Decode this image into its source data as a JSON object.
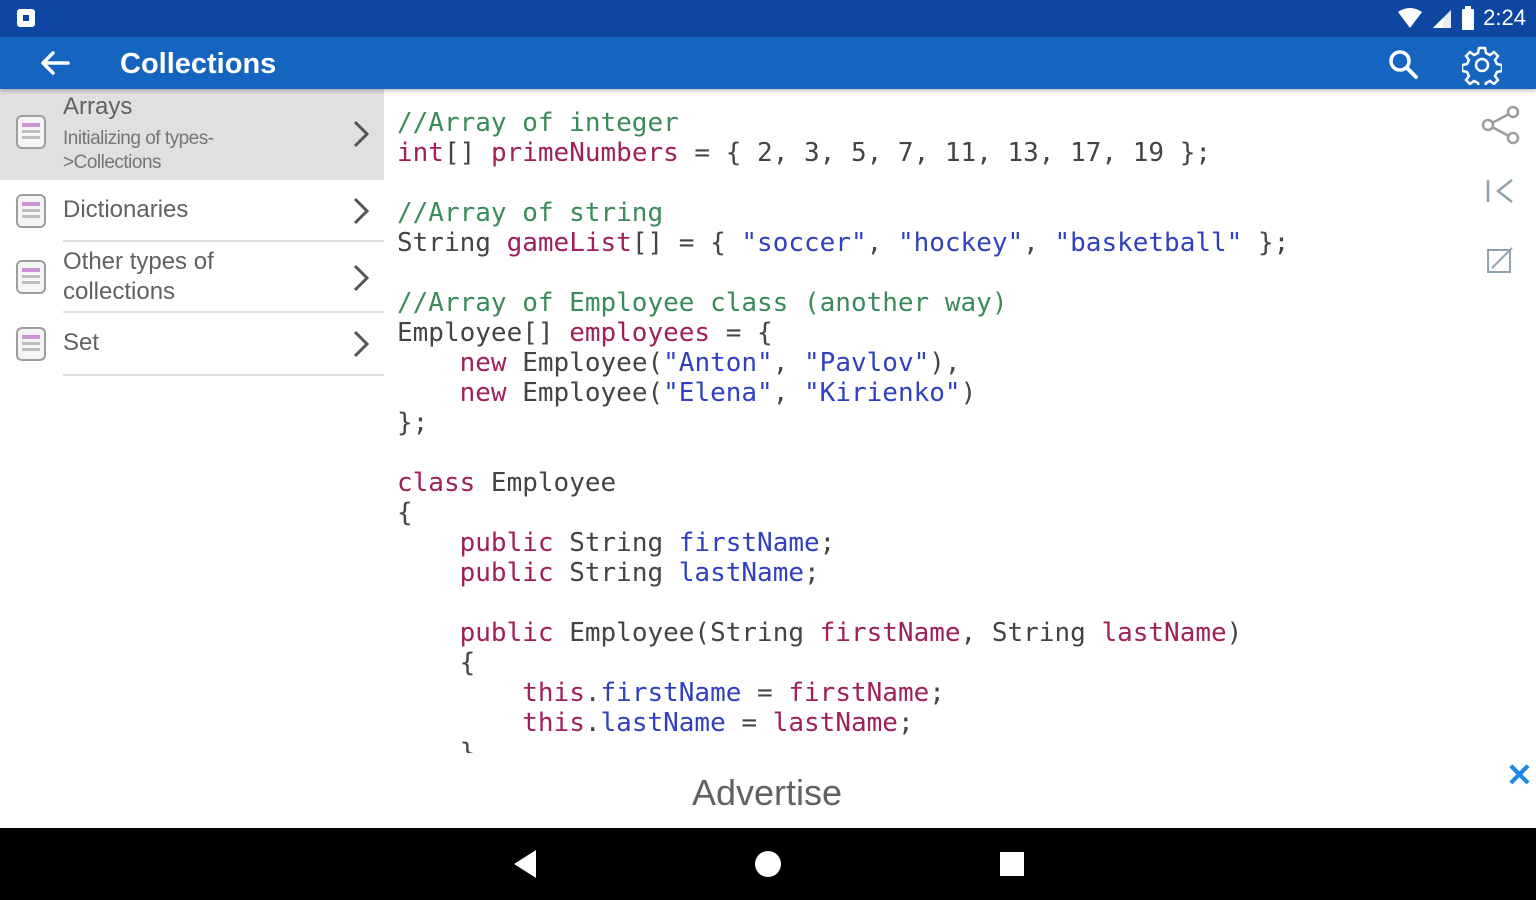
{
  "status_bar": {
    "time": "2:24"
  },
  "app_bar": {
    "title": "Collections"
  },
  "sidebar": {
    "items": [
      {
        "label": "Arrays",
        "sublabel_line1": "Initializing of types-",
        "sublabel_line2": ">Collections",
        "selected": true
      },
      {
        "label": "Dictionaries"
      },
      {
        "label_line1": "Other types of",
        "label_line2": "collections"
      },
      {
        "label": "Set"
      }
    ]
  },
  "code_lines": [
    [
      [
        "cm",
        "//Array of integer"
      ]
    ],
    [
      [
        "kw",
        "int"
      ],
      [
        "tx",
        "[] "
      ],
      [
        "pl",
        "primeNumbers"
      ],
      [
        "tx",
        " = { 2, 3, 5, 7, 11, 13, 17, 19 };"
      ]
    ],
    [],
    [
      [
        "cm",
        "//Array of string"
      ]
    ],
    [
      [
        "tx",
        "String "
      ],
      [
        "pl",
        "gameList"
      ],
      [
        "tx",
        "[] = { "
      ],
      [
        "st",
        "\"soccer\""
      ],
      [
        "tx",
        ", "
      ],
      [
        "st",
        "\"hockey\""
      ],
      [
        "tx",
        ", "
      ],
      [
        "st",
        "\"basketball\""
      ],
      [
        "tx",
        " };"
      ]
    ],
    [],
    [
      [
        "cm",
        "//Array of Employee class (another way)"
      ]
    ],
    [
      [
        "tx",
        "Employee[] "
      ],
      [
        "pl",
        "employees"
      ],
      [
        "tx",
        " = {"
      ]
    ],
    [
      [
        "tx",
        "    "
      ],
      [
        "kw",
        "new"
      ],
      [
        "tx",
        " Employee("
      ],
      [
        "st",
        "\"Anton\""
      ],
      [
        "tx",
        ", "
      ],
      [
        "st",
        "\"Pavlov\""
      ],
      [
        "tx",
        "),"
      ]
    ],
    [
      [
        "tx",
        "    "
      ],
      [
        "kw",
        "new"
      ],
      [
        "tx",
        " Employee("
      ],
      [
        "st",
        "\"Elena\""
      ],
      [
        "tx",
        ", "
      ],
      [
        "st",
        "\"Kirienko\""
      ],
      [
        "tx",
        ")"
      ]
    ],
    [
      [
        "tx",
        "};"
      ]
    ],
    [],
    [
      [
        "kw",
        "class"
      ],
      [
        "tx",
        " Employee"
      ]
    ],
    [
      [
        "tx",
        "{"
      ]
    ],
    [
      [
        "tx",
        "    "
      ],
      [
        "kw",
        "public"
      ],
      [
        "tx",
        " String "
      ],
      [
        "fd",
        "firstName"
      ],
      [
        "tx",
        ";"
      ]
    ],
    [
      [
        "tx",
        "    "
      ],
      [
        "kw",
        "public"
      ],
      [
        "tx",
        " String "
      ],
      [
        "fd",
        "lastName"
      ],
      [
        "tx",
        ";"
      ]
    ],
    [],
    [
      [
        "tx",
        "    "
      ],
      [
        "kw",
        "public"
      ],
      [
        "tx",
        " Employee(String "
      ],
      [
        "pl",
        "firstName"
      ],
      [
        "tx",
        ", String "
      ],
      [
        "pl",
        "lastName"
      ],
      [
        "tx",
        ")"
      ]
    ],
    [
      [
        "tx",
        "    {"
      ]
    ],
    [
      [
        "tx",
        "        "
      ],
      [
        "kw",
        "this"
      ],
      [
        "tx",
        "."
      ],
      [
        "fd",
        "firstName"
      ],
      [
        "tx",
        " = "
      ],
      [
        "pl",
        "firstName"
      ],
      [
        "tx",
        ";"
      ]
    ],
    [
      [
        "tx",
        "        "
      ],
      [
        "kw",
        "this"
      ],
      [
        "tx",
        "."
      ],
      [
        "fd",
        "lastName"
      ],
      [
        "tx",
        " = "
      ],
      [
        "pl",
        "lastName"
      ],
      [
        "tx",
        ";"
      ]
    ],
    [
      [
        "tx",
        "    }"
      ]
    ]
  ],
  "ad_banner": {
    "text": "Advertise",
    "close_glyph": "✕"
  },
  "icons": {
    "back": "back-arrow-icon",
    "search": "search-icon",
    "settings": "gear-icon",
    "share": "share-icon",
    "first_page": "first-page-icon",
    "edit": "edit-icon",
    "nav_back": "nav-back-icon",
    "nav_home": "nav-home-icon",
    "nav_recents": "nav-recents-icon"
  },
  "colors": {
    "status_bar": "#0d47a1",
    "app_bar": "#1565c0",
    "comment": "#3a8a5a",
    "keyword": "#a0205a",
    "string": "#3040c0",
    "selected_item": "#e0e0e0"
  }
}
